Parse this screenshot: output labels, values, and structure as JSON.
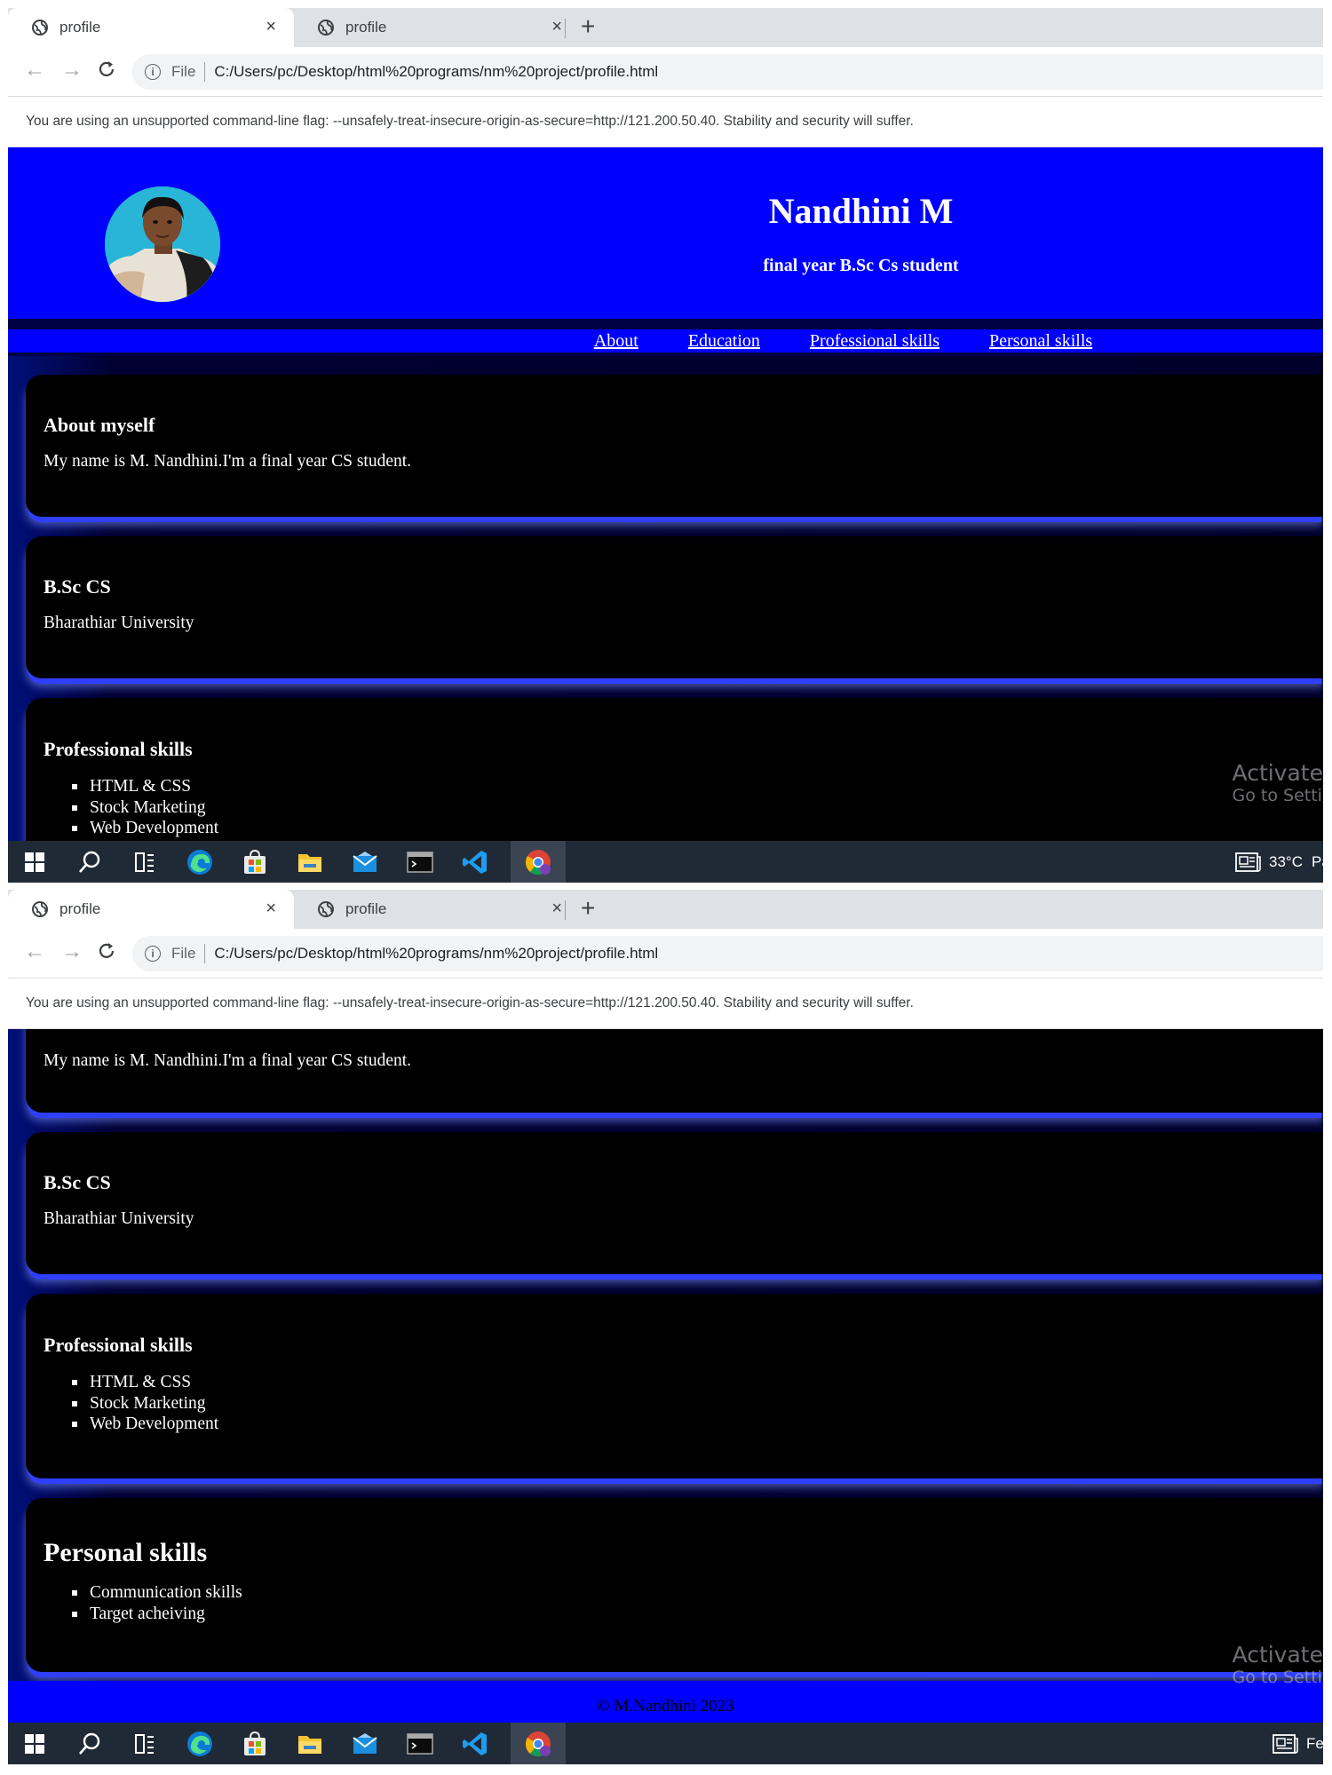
{
  "browser": {
    "tabs": [
      {
        "title": "profile",
        "close": "×"
      },
      {
        "title": "profile",
        "close": "×"
      }
    ],
    "new_tab": "+",
    "nav": {
      "back": "←",
      "forward": "→",
      "reload": "C"
    },
    "omnibox": {
      "info": "i",
      "scheme": "File",
      "url": "C:/Users/pc/Desktop/html%20programs/nm%20project/profile.html"
    },
    "infobar": "You are using an unsupported command-line flag: --unsafely-treat-insecure-origin-as-secure=http://121.200.50.40. Stability and security will suffer."
  },
  "page": {
    "name": "Nandhini M",
    "subtitle": "final year B.Sc Cs student",
    "nav": [
      "About",
      "Education",
      "Professional skills",
      "Personal skills"
    ],
    "about": {
      "heading": "About myself",
      "text": "My name is M. Nandhini.I'm a final year CS student."
    },
    "education": {
      "heading": "B.Sc CS",
      "text": "Bharathiar University"
    },
    "professional": {
      "heading": "Professional skills",
      "items": [
        "HTML & CSS",
        "Stock Marketing",
        "Web Development"
      ]
    },
    "personal": {
      "heading": "Personal skills",
      "items": [
        "Communication skills",
        "Target acheiving"
      ]
    },
    "footer": "© M.Nandhini 2023"
  },
  "watermark": {
    "title": "Activate",
    "subtitle": "Go to Setti"
  },
  "taskbar": {
    "icons": [
      "windows-start-icon",
      "search-icon",
      "task-view-icon",
      "edge-icon",
      "store-icon",
      "file-explorer-icon",
      "mail-icon",
      "terminal-icon",
      "vscode-icon",
      "chrome-icon"
    ],
    "weather_1": "33°C",
    "weather_1_suffix": "Pa",
    "weather_2_suffix": "Fe"
  },
  "colors": {
    "page_blue": "#0000ff",
    "dark_background": "#00002a",
    "section": "#000000",
    "taskbar": "#202a36"
  }
}
